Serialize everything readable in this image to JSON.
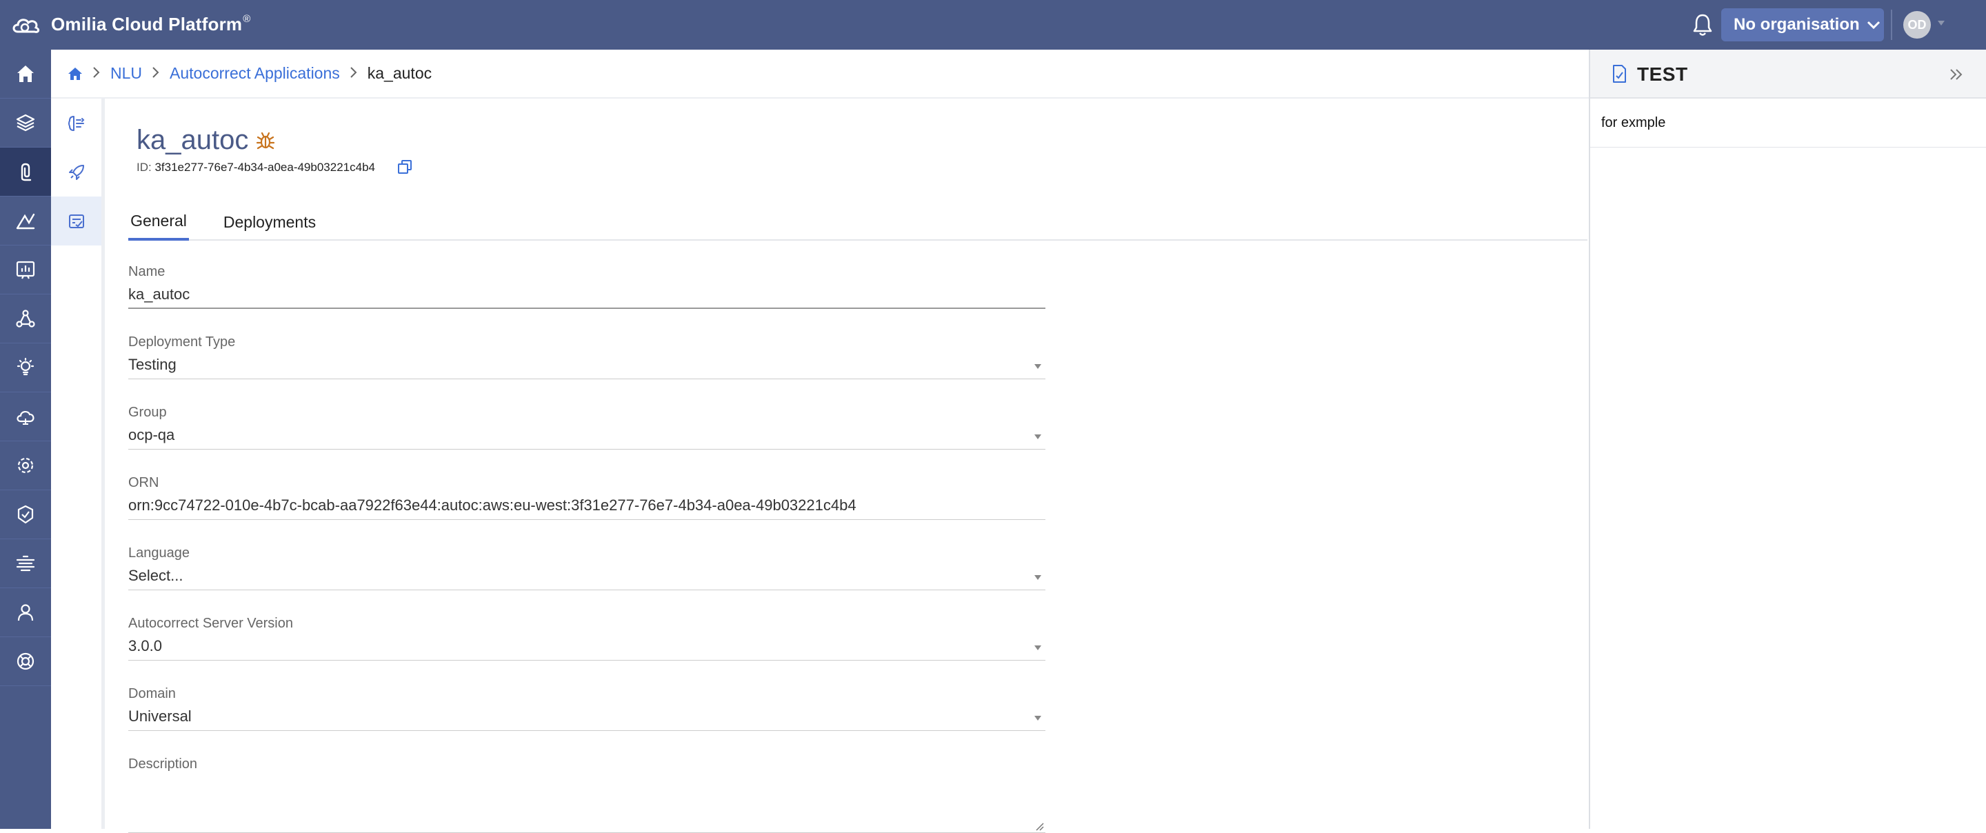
{
  "topbar": {
    "app_title": "Omilia Cloud Platform",
    "registered_mark": "®",
    "org_button_label": "No organisation",
    "avatar_initials": "OD"
  },
  "sidebar": {
    "items": [
      {
        "icon": "home-icon"
      },
      {
        "icon": "layers-icon"
      },
      {
        "icon": "nlu-icon",
        "active": true
      },
      {
        "icon": "analytics-icon"
      },
      {
        "icon": "reports-icon"
      },
      {
        "icon": "integrations-icon"
      },
      {
        "icon": "insights-icon"
      },
      {
        "icon": "cloud-icon"
      },
      {
        "icon": "settings-icon"
      },
      {
        "icon": "security-icon"
      },
      {
        "icon": "speech-icon"
      },
      {
        "icon": "user-icon"
      },
      {
        "icon": "support-icon"
      }
    ]
  },
  "subnav": {
    "items": [
      {
        "icon": "brain-icon"
      },
      {
        "icon": "rocket-icon"
      },
      {
        "icon": "autocorrect-icon",
        "active": true
      }
    ]
  },
  "breadcrumb": {
    "items": [
      "NLU",
      "Autocorrect Applications"
    ],
    "current": "ka_autoc"
  },
  "page": {
    "title": "ka_autoc",
    "id_label": "ID:",
    "id_value": "3f31e277-76e7-4b34-a0ea-49b03221c4b4"
  },
  "tabs": [
    {
      "label": "General",
      "active": true
    },
    {
      "label": "Deployments",
      "active": false
    }
  ],
  "form": {
    "name": {
      "label": "Name",
      "value": "ka_autoc"
    },
    "deployment_type": {
      "label": "Deployment Type",
      "value": "Testing"
    },
    "group": {
      "label": "Group",
      "value": "ocp-qa"
    },
    "orn": {
      "label": "ORN",
      "value": "orn:9cc74722-010e-4b7c-bcab-aa7922f63e44:autoc:aws:eu-west:3f31e277-76e7-4b34-a0ea-49b03221c4b4"
    },
    "language": {
      "label": "Language",
      "placeholder": "Select..."
    },
    "server_version": {
      "label": "Autocorrect Server Version",
      "value": "3.0.0"
    },
    "domain": {
      "label": "Domain",
      "value": "Universal"
    },
    "description": {
      "label": "Description",
      "value": ""
    }
  },
  "test_panel": {
    "title": "TEST",
    "input_value": "for exmple"
  },
  "colors": {
    "topbar": "#4a5a87",
    "sidebar_active": "#2e3c66",
    "accent": "#3a6fd8",
    "bug_icon": "#c8741e"
  }
}
